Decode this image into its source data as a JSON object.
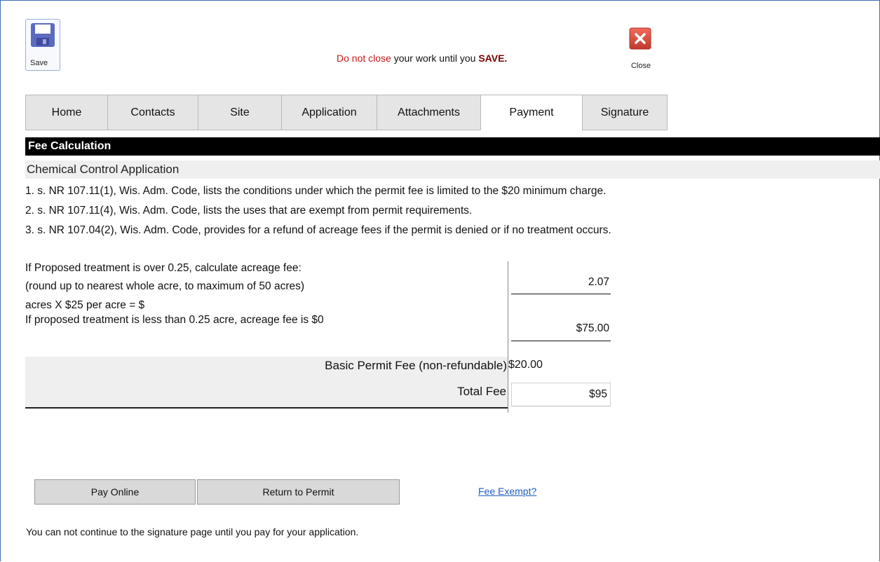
{
  "toolbar": {
    "save_label": "Save",
    "close_label": "Close",
    "warning_red": "Do not close",
    "warning_mid": " your work until you ",
    "warning_bold": "SAVE."
  },
  "tabs": [
    {
      "label": "Home",
      "active": false
    },
    {
      "label": "Contacts",
      "active": false
    },
    {
      "label": "Site",
      "active": false
    },
    {
      "label": "Application",
      "active": false
    },
    {
      "label": "Attachments",
      "active": false
    },
    {
      "label": "Payment",
      "active": true
    },
    {
      "label": "Signature",
      "active": false
    }
  ],
  "section": {
    "title": "Fee Calculation",
    "subtitle": "Chemical Control Application"
  },
  "notes": [
    "1. s. NR 107.11(1), Wis. Adm. Code, lists the conditions under which the permit fee is limited to the $20 minimum charge.",
    "2. s. NR 107.11(4), Wis. Adm. Code, lists the uses that are exempt from permit requirements.",
    "3. s. NR 107.04(2), Wis. Adm. Code, provides for a refund of acreage fees if the permit is denied or if no treatment occurs."
  ],
  "calc": {
    "line1": " If Proposed treatment is over  0.25, calculate acreage fee:",
    "line2": "(round up to nearest whole acre, to maximum of 50 acres)",
    "line3": " acres X $25 per acre = $",
    "line4": "If proposed treatment is less than 0.25 acre, acreage fee is $0",
    "acres_value": "2.07",
    "acreage_fee": "$75.00",
    "basic_fee_label": "Basic Permit Fee (non-refundable)",
    "basic_fee_value": "$20.00",
    "total_label": "Total Fee",
    "total_value": "$95"
  },
  "actions": {
    "pay_online": "Pay Online",
    "return_to_permit": "Return to Permit",
    "fee_exempt": "Fee Exempt?"
  },
  "footer_note": "You can not continue to the signature page until you pay for your application.",
  "colors": {
    "warning": "#c41a1a",
    "header_bg": "#000000",
    "link": "#1f5fc1",
    "tab_bg": "#e5e5e5"
  }
}
